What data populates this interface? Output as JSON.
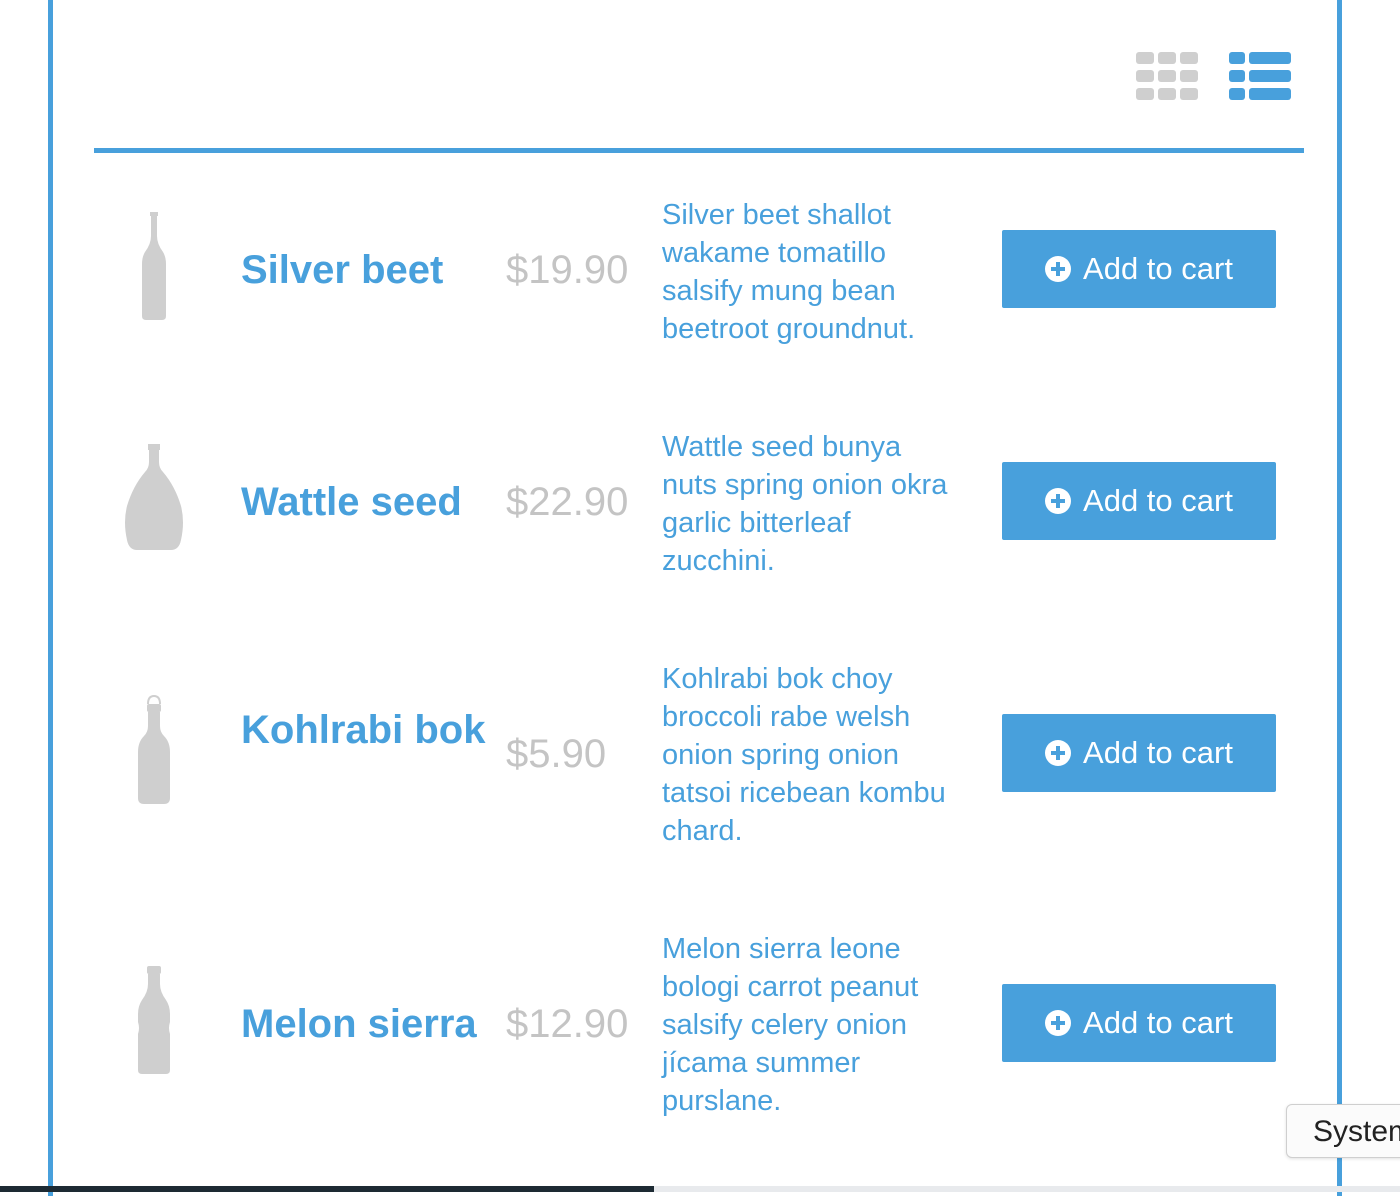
{
  "colors": {
    "accent": "#48a0dc",
    "price_gray": "#c4c4c4",
    "icon_gray": "#cfcfcf",
    "button_text": "#ffffff"
  },
  "view_toggle": {
    "grid_icon": "grid-view-icon",
    "list_icon": "list-view-icon",
    "active": "list"
  },
  "products": [
    {
      "name": "Silver beet",
      "price": "$19.90",
      "description": "Silver beet shallot wakame tomatillo salsify mung bean beetroot groundnut.",
      "button_label": "Add to cart",
      "icon": "tall-bottle-icon"
    },
    {
      "name": "Wattle seed",
      "price": "$22.90",
      "description": "Wattle seed bunya nuts spring onion okra garlic bitterleaf zucchini.",
      "button_label": "Add to cart",
      "icon": "round-bottle-icon"
    },
    {
      "name": "Kohlrabi bok",
      "price": "$5.90",
      "description": "Kohlrabi bok choy broccoli rabe welsh onion spring onion tatsoi ricebean kombu chard.",
      "button_label": "Add to cart",
      "icon": "swing-top-bottle-icon"
    },
    {
      "name": "Melon sierra",
      "price": "$12.90",
      "description": "Melon sierra leone bologi carrot peanut salsify celery onion jícama summer purslane.",
      "button_label": "Add to cart",
      "icon": "soda-bottle-icon"
    }
  ],
  "system_tooltip": "System"
}
